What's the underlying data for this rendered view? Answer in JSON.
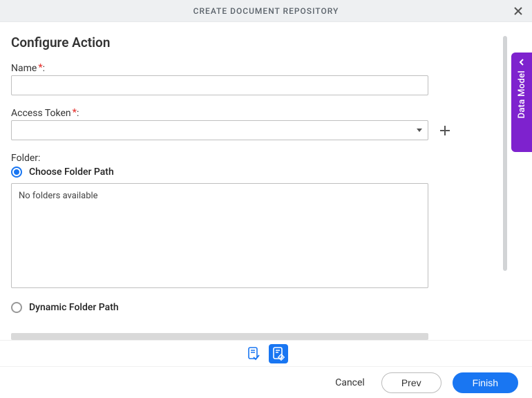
{
  "titlebar": {
    "title": "CREATE DOCUMENT REPOSITORY"
  },
  "section": {
    "heading": "Configure Action"
  },
  "fields": {
    "name": {
      "label": "Name",
      "required": "*",
      "colon": ":",
      "value": ""
    },
    "access_token": {
      "label": "Access Token",
      "required": "*",
      "colon": ":",
      "selected": ""
    },
    "folder": {
      "label": "Folder:",
      "choose_label": "Choose Folder Path",
      "empty_text": "No folders available",
      "dynamic_label": "Dynamic Folder Path"
    }
  },
  "side_tab": {
    "label": "Data Model"
  },
  "footer": {
    "cancel": "Cancel",
    "prev": "Prev",
    "finish": "Finish"
  }
}
